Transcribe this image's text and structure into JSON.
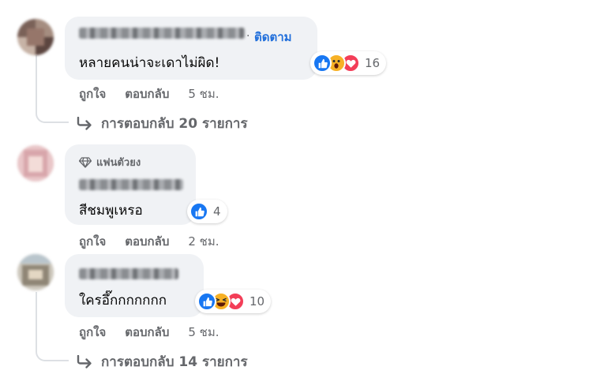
{
  "comments": [
    {
      "follow_label": "ติดตาม",
      "text": "หลายคนน่าจะเดาไม่ผิด!",
      "reaction_count": "16",
      "reactions": [
        "like-icon",
        "wow-icon",
        "love-icon"
      ],
      "actions": {
        "like": "ถูกใจ",
        "reply": "ตอบกลับ",
        "time": "5 ชม."
      },
      "replies_label": "การตอบกลับ 20 รายการ"
    },
    {
      "badge": "แฟนตัวยง",
      "text": "สีชมพูเหรอ",
      "reaction_count": "4",
      "reactions": [
        "like-icon"
      ],
      "actions": {
        "like": "ถูกใจ",
        "reply": "ตอบกลับ",
        "time": "2 ชม."
      }
    },
    {
      "text": "ใครอึ๊กกกกกกก",
      "reaction_count": "10",
      "reactions": [
        "like-icon",
        "haha-icon",
        "love-icon"
      ],
      "actions": {
        "like": "ถูกใจ",
        "reply": "ตอบกลับ",
        "time": "5 ชม."
      },
      "replies_label": "การตอบกลับ 14 รายการ"
    }
  ],
  "colors": {
    "bubble": "#f0f2f5",
    "link_blue": "#216fdb",
    "secondary_text": "#65676b",
    "like_blue": "#1877f2",
    "love_red": "#f33e58",
    "wow_yellow": "#f7b125",
    "thread_line": "#dde0e4"
  }
}
